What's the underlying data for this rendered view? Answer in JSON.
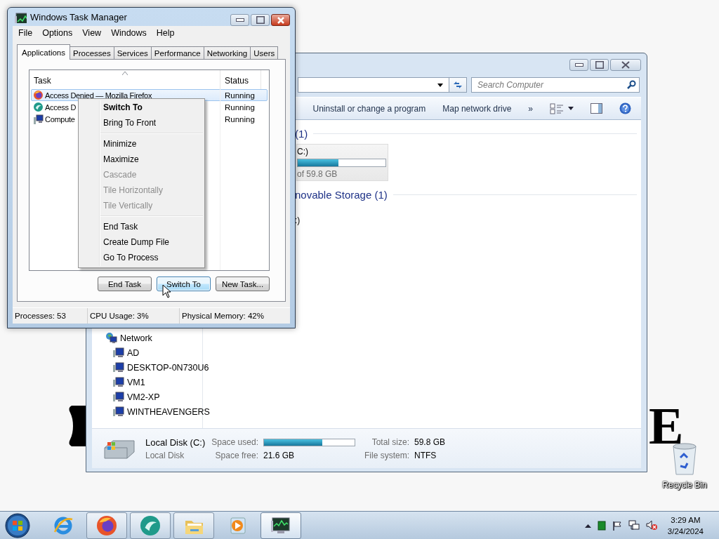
{
  "wallpaper": {
    "letter": "E"
  },
  "desktop_icons": [
    {
      "label": "Recycle Bin"
    }
  ],
  "explorer": {
    "search": {
      "placeholder": "Search Computer"
    },
    "toolbar": [
      {
        "label": "Uninstall or change a program"
      },
      {
        "label": "Map network drive"
      },
      {
        "label": "»"
      }
    ],
    "sections": [
      {
        "heading": "(1)",
        "drives": [
          {
            "name": "C:)",
            "level": 0.46,
            "size": "of 59.8 GB"
          }
        ]
      },
      {
        "heading": "novable Storage (1)",
        "drives": [
          {
            "name": ":)"
          }
        ]
      }
    ],
    "nav": [
      {
        "label": "Network",
        "kind": "network",
        "children": [
          {
            "label": "AD",
            "kind": "computer"
          },
          {
            "label": "DESKTOP-0N730U6",
            "kind": "computer"
          },
          {
            "label": "VM1",
            "kind": "computer"
          },
          {
            "label": "VM2-XP",
            "kind": "computer"
          },
          {
            "label": "WINTHEAVENGERS",
            "kind": "computer"
          }
        ]
      }
    ],
    "details": {
      "name": "Local Disk (C:)",
      "type": "Local Disk",
      "space_used_label": "Space used:",
      "level": 0.64,
      "space_free_label": "Space free:",
      "space_free": "21.6 GB",
      "total_size_label": "Total size:",
      "total_size": "59.8 GB",
      "file_system_label": "File system:",
      "file_system": "NTFS"
    }
  },
  "task_manager": {
    "title": "Windows Task Manager",
    "menu": [
      "File",
      "Options",
      "View",
      "Windows",
      "Help"
    ],
    "tabs": [
      {
        "label": "Applications",
        "selected": true
      },
      {
        "label": "Processes",
        "selected": false
      },
      {
        "label": "Services",
        "selected": false
      },
      {
        "label": "Performance",
        "selected": false
      },
      {
        "label": "Networking",
        "selected": false
      },
      {
        "label": "Users",
        "selected": false
      }
    ],
    "columns": [
      {
        "label": "Task",
        "sorted": true
      },
      {
        "label": "Status",
        "sorted": false
      }
    ],
    "rows": [
      {
        "task": "Access Denied — Mozilla Firefox",
        "status": "Running",
        "kind": "firefox",
        "selected": true
      },
      {
        "task": "Access D",
        "status": "Running",
        "kind": "round",
        "selected": false
      },
      {
        "task": "Compute",
        "status": "Running",
        "kind": "computer",
        "selected": false
      }
    ],
    "buttons": [
      {
        "label": "End Task",
        "focused": false
      },
      {
        "label": "Switch To",
        "focused": true
      },
      {
        "label": "New Task...",
        "focused": false
      }
    ],
    "status_bar": [
      "Processes: 53",
      "CPU Usage: 3%",
      "Physical Memory: 42%"
    ]
  },
  "context_menu": [
    {
      "kind": "item",
      "label": "Switch To",
      "default": true,
      "disabled": false
    },
    {
      "kind": "item",
      "label": "Bring To Front",
      "default": false,
      "disabled": false
    },
    {
      "kind": "separator"
    },
    {
      "kind": "item",
      "label": "Minimize",
      "default": false,
      "disabled": false
    },
    {
      "kind": "item",
      "label": "Maximize",
      "default": false,
      "disabled": false
    },
    {
      "kind": "item",
      "label": "Cascade",
      "default": false,
      "disabled": true
    },
    {
      "kind": "item",
      "label": "Tile Horizontally",
      "default": false,
      "disabled": true
    },
    {
      "kind": "item",
      "label": "Tile Vertically",
      "default": false,
      "disabled": true
    },
    {
      "kind": "separator"
    },
    {
      "kind": "item",
      "label": "End Task",
      "default": false,
      "disabled": false
    },
    {
      "kind": "item",
      "label": "Create Dump File",
      "default": false,
      "disabled": false
    },
    {
      "kind": "item",
      "label": "Go To Process",
      "default": false,
      "disabled": false
    }
  ],
  "taskbar": {
    "items": [
      {
        "kind": "ie",
        "running": false,
        "active": false
      },
      {
        "kind": "firefox",
        "running": true,
        "active": false
      },
      {
        "kind": "round",
        "running": true,
        "active": false
      },
      {
        "kind": "folder",
        "running": true,
        "active": false
      },
      {
        "kind": "media",
        "running": false,
        "active": false
      },
      {
        "kind": "taskmgr",
        "running": true,
        "active": true
      }
    ],
    "time": "3:29 AM",
    "date": "3/24/2024"
  }
}
